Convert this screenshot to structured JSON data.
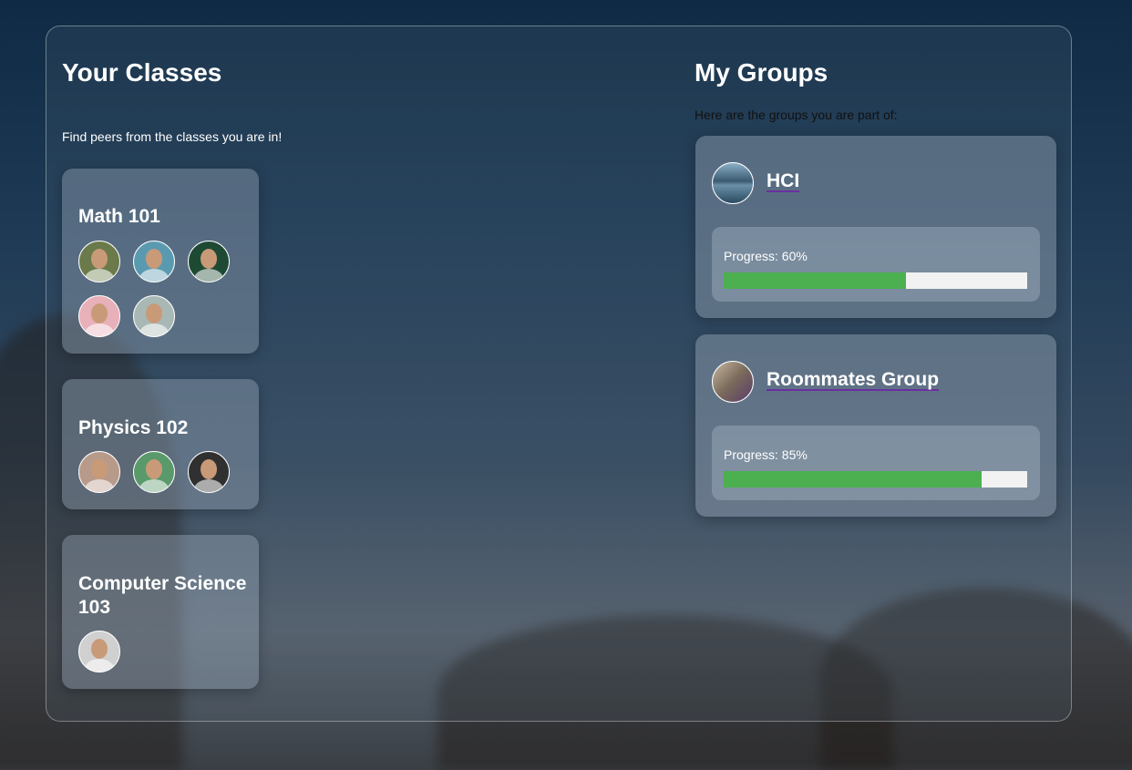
{
  "classes": {
    "title": "Your Classes",
    "subtitle": "Find peers from the classes you are in!",
    "items": [
      {
        "name": "Math 101",
        "avatars": [
          "#6a7a4a",
          "#5a9ab0",
          "#1e4a34",
          "#e8b0b8",
          "#a8b8b4"
        ]
      },
      {
        "name": "Physics 102",
        "avatars": [
          "#b89a8a",
          "#5a9a6a",
          "#303030"
        ]
      },
      {
        "name": "Computer Science 103",
        "avatars": [
          "#d0d0d0"
        ]
      }
    ]
  },
  "groups": {
    "title": "My Groups",
    "subtitle": "Here are the groups you are part of:",
    "items": [
      {
        "name": "HCI",
        "progress_label": "Progress: 60%",
        "progress": 60,
        "icon": "mountain-lake-image",
        "icon_color": "#4a7a9a"
      },
      {
        "name": "Roommates Group",
        "progress_label": "Progress: 85%",
        "progress": 85,
        "icon": "room-image",
        "icon_color": "#7a6a5a"
      }
    ]
  },
  "colors": {
    "progress_fill": "#4caf50",
    "progress_track": "#f2f2f2",
    "link_underline": "#6b2fa0"
  }
}
